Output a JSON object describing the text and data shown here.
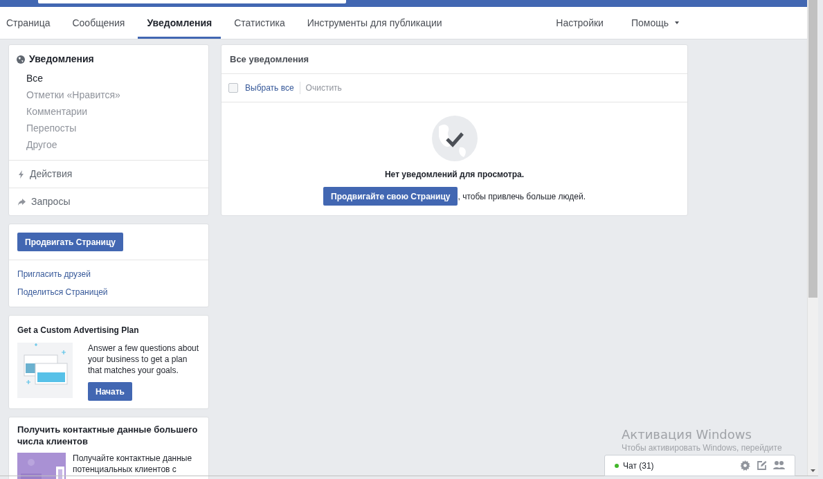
{
  "tabs": [
    {
      "label": "Страница",
      "selected": false
    },
    {
      "label": "Сообщения",
      "selected": false
    },
    {
      "label": "Уведомления",
      "selected": true
    },
    {
      "label": "Статистика",
      "selected": false
    },
    {
      "label": "Инструменты для публикации",
      "selected": false
    }
  ],
  "right_tabs": [
    {
      "label": "Настройки",
      "dropdown": false
    },
    {
      "label": "Помощь",
      "dropdown": true
    }
  ],
  "sidebar": {
    "title": "Уведомления",
    "filters": [
      {
        "label": "Все",
        "selected": true
      },
      {
        "label": "Отметки «Нравится»",
        "selected": false
      },
      {
        "label": "Комментарии",
        "selected": false
      },
      {
        "label": "Перепосты",
        "selected": false
      },
      {
        "label": "Другое",
        "selected": false
      }
    ],
    "sections": [
      {
        "kind": "bolt",
        "label": "Действия"
      },
      {
        "kind": "share",
        "label": "Запросы"
      }
    ]
  },
  "promote_card": {
    "button": "Продвигать Страницу",
    "links": [
      "Пригласить друзей",
      "Поделиться Страницей"
    ]
  },
  "ad_plan_card": {
    "title": "Get a Custom Advertising Plan",
    "text": "Answer a few questions about your business to get a plan that matches your goals.",
    "button": "Начать"
  },
  "leads_card": {
    "title": "Получить контактные данные большего числа клиентов",
    "text": "Получайте контактные данные потенциальных клиентов с"
  },
  "notifications": {
    "title": "Все уведомления",
    "select_all": {
      "label": "Выбрать все",
      "checked": false
    },
    "clear": "Очистить",
    "empty_text": "Нет уведомлений для просмотра.",
    "promote_button": "Продвигайте свою Страницу",
    "promote_suffix": ", чтобы привлечь больше людей."
  },
  "chat": {
    "label": "Чат (31)",
    "online": true
  },
  "windows_notice": {
    "title": "Активация Windows",
    "text": "Чтобы активировать Windows, перейдите"
  }
}
